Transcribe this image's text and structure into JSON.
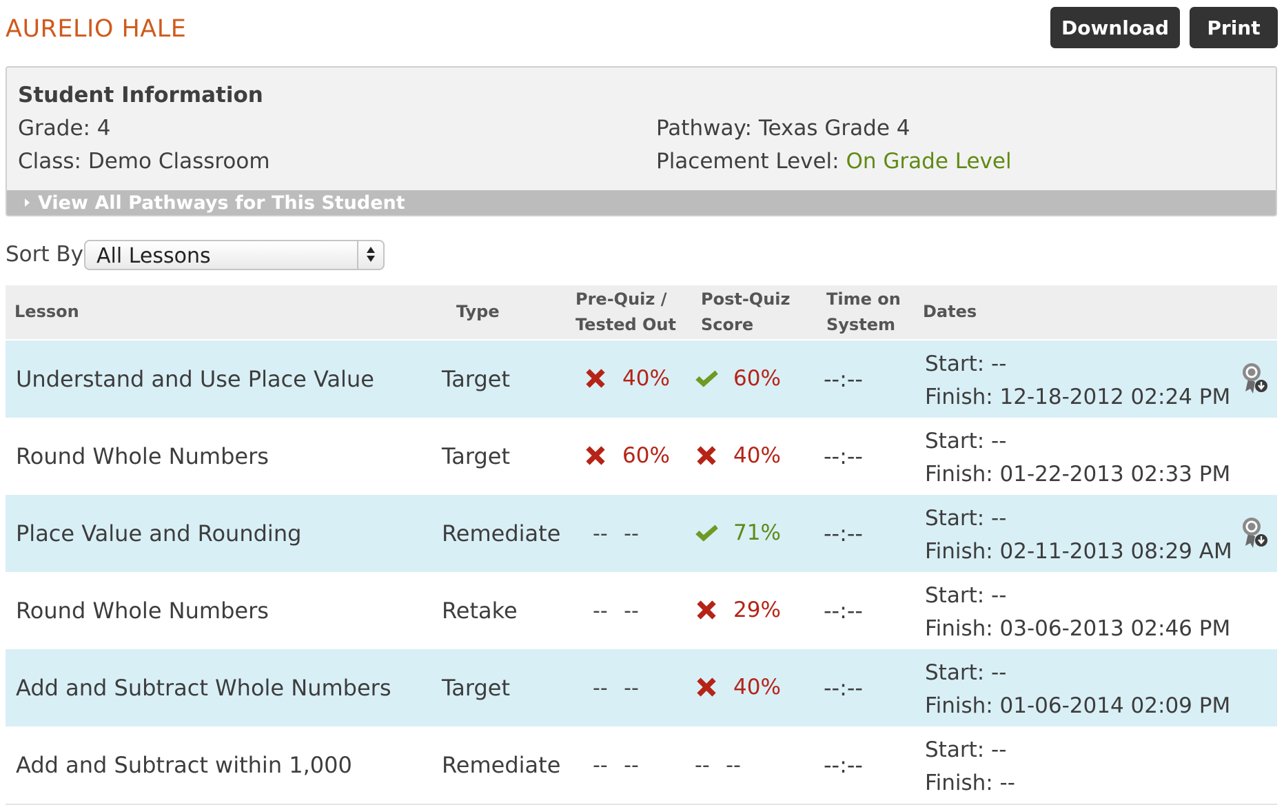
{
  "student": {
    "name": "AURELIO HALE",
    "name_color": "#cf5a1c"
  },
  "toolbar": {
    "download_label": "Download",
    "print_label": "Print"
  },
  "info": {
    "title": "Student Information",
    "grade": "Grade: 4",
    "class": "Class: Demo Classroom",
    "pathway": "Pathway: Texas Grade 4",
    "placement_label": "Placement Level: ",
    "placement_value": "On Grade Level",
    "pathways_link": "View All Pathways for This Student"
  },
  "sort": {
    "label": "Sort By:",
    "selected": "All Lessons"
  },
  "table": {
    "headers": {
      "lesson": "Lesson",
      "type": "Type",
      "pre_line1": "Pre-Quiz /",
      "pre_line2": "Tested Out",
      "post_line1": "Post-Quiz",
      "post_line2": "Score",
      "time_line1": "Time on",
      "time_line2": "System",
      "dates": "Dates"
    },
    "rows": [
      {
        "lesson": "Understand and Use Place Value",
        "type": "Target",
        "pre": {
          "status": "fail",
          "percent": "40%"
        },
        "post": {
          "status": "pass",
          "percent": "60%",
          "color": "red"
        },
        "time": "--:--",
        "start": "Start: --",
        "finish": "Finish: 12-18-2012 02:24 PM",
        "award": true
      },
      {
        "lesson": "Round Whole Numbers",
        "type": "Target",
        "pre": {
          "status": "fail",
          "percent": "60%"
        },
        "post": {
          "status": "fail",
          "percent": "40%",
          "color": "red"
        },
        "time": "--:--",
        "start": "Start: --",
        "finish": "Finish: 01-22-2013 02:33 PM",
        "award": false
      },
      {
        "lesson": "Place Value and Rounding",
        "type": "Remediate",
        "pre": {
          "status": "none",
          "text": "-- --"
        },
        "post": {
          "status": "pass",
          "percent": "71%",
          "color": "green"
        },
        "time": "--:--",
        "start": "Start: --",
        "finish": "Finish: 02-11-2013 08:29 AM",
        "award": true
      },
      {
        "lesson": "Round Whole Numbers",
        "type": "Retake",
        "pre": {
          "status": "none",
          "text": "-- --"
        },
        "post": {
          "status": "fail",
          "percent": "29%",
          "color": "red"
        },
        "time": "--:--",
        "start": "Start: --",
        "finish": "Finish: 03-06-2013 02:46 PM",
        "award": false
      },
      {
        "lesson": "Add and Subtract Whole Numbers",
        "type": "Target",
        "pre": {
          "status": "none",
          "text": "-- --"
        },
        "post": {
          "status": "fail",
          "percent": "40%",
          "color": "red"
        },
        "time": "--:--",
        "start": "Start: --",
        "finish": "Finish: 01-06-2014 02:09 PM",
        "award": false
      },
      {
        "lesson": "Add and Subtract within 1,000",
        "type": "Remediate",
        "pre": {
          "status": "none",
          "text": "-- --"
        },
        "post": {
          "status": "none",
          "text": "-- --"
        },
        "time": "--:--",
        "start": "Start: --",
        "finish": "Finish: --",
        "award": false
      }
    ]
  },
  "colors": {
    "fail_icon": "#b52417",
    "pass_icon": "#6f9a23",
    "alt_row_bg": "#d9eff6",
    "button_bg": "#333333"
  },
  "icons": {
    "fail": "x-mark-icon",
    "pass": "checkmark-icon",
    "award": "award-download-icon",
    "expand": "caret-right-icon",
    "select": "up-down-arrows-icon"
  }
}
